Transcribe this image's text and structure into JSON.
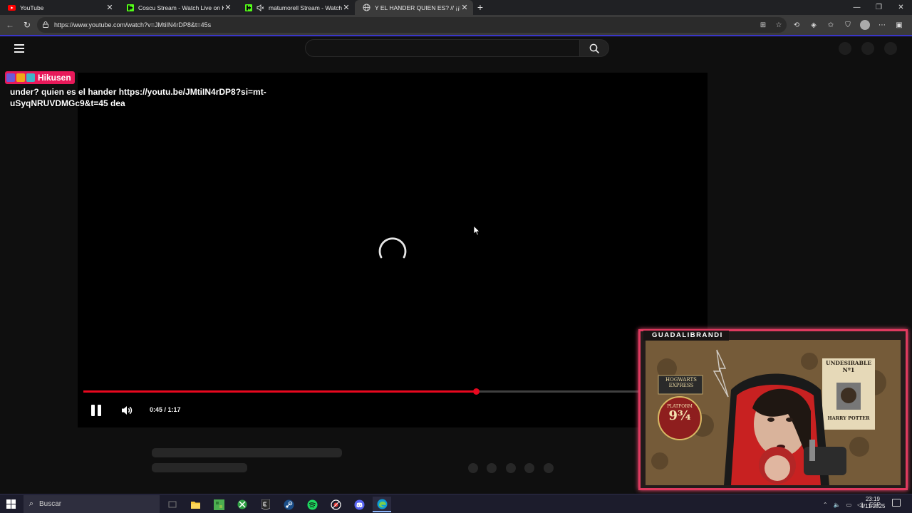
{
  "browser": {
    "tabs": [
      {
        "title": "YouTube",
        "favicon": "youtube-icon",
        "active": false
      },
      {
        "title": "Coscu Stream - Watch Live on Kick",
        "favicon": "kick-icon",
        "active": false
      },
      {
        "title": "matumorell Stream - Watch Live",
        "favicon": "kick-icon",
        "active": false
      },
      {
        "title": "Y EL HANDER QUIEN ES? // ¡¡INC",
        "favicon": "globe-icon",
        "active": true
      }
    ],
    "url": "https://www.youtube.com/watch?v=JMtiIN4rDP8&t=45s",
    "accent": "#3a36c9"
  },
  "player": {
    "time_current": "0:45",
    "time_total": "1:17",
    "time_display": "0:45 / 1:17",
    "progress_fraction": 0.633,
    "progress_color": "#e9081f",
    "state": "loading"
  },
  "chat": {
    "username": "Hikusen",
    "message": "under? quien es el hander https://youtu.be/JMtiIN4rDP8?si=mt-uSyqNRUVDMGc9&t=45 dea",
    "name_color": "#e8195a"
  },
  "webcam": {
    "label": "GUADALIBRANDI",
    "frame_color": "#e03a5f",
    "posters": {
      "hogwarts_line1": "HOGWARTS",
      "hogwarts_line2": "EXPRESS",
      "platform_label": "PLATFORM",
      "platform_number": "9¾",
      "undesirable_title": "UNDESIRABLE",
      "undesirable_no": "Nº1",
      "undesirable_name": "HARRY POTTER"
    }
  },
  "taskbar": {
    "search_placeholder": "Buscar",
    "language": "ESP",
    "time": "23:19",
    "date": "4/11/2025",
    "apps": [
      "task-view-icon",
      "file-explorer-icon",
      "minecraft-icon",
      "xbox-icon",
      "epic-games-icon",
      "steam-icon",
      "spotify-icon",
      "media-player-icon",
      "discord-icon",
      "edge-icon"
    ]
  }
}
